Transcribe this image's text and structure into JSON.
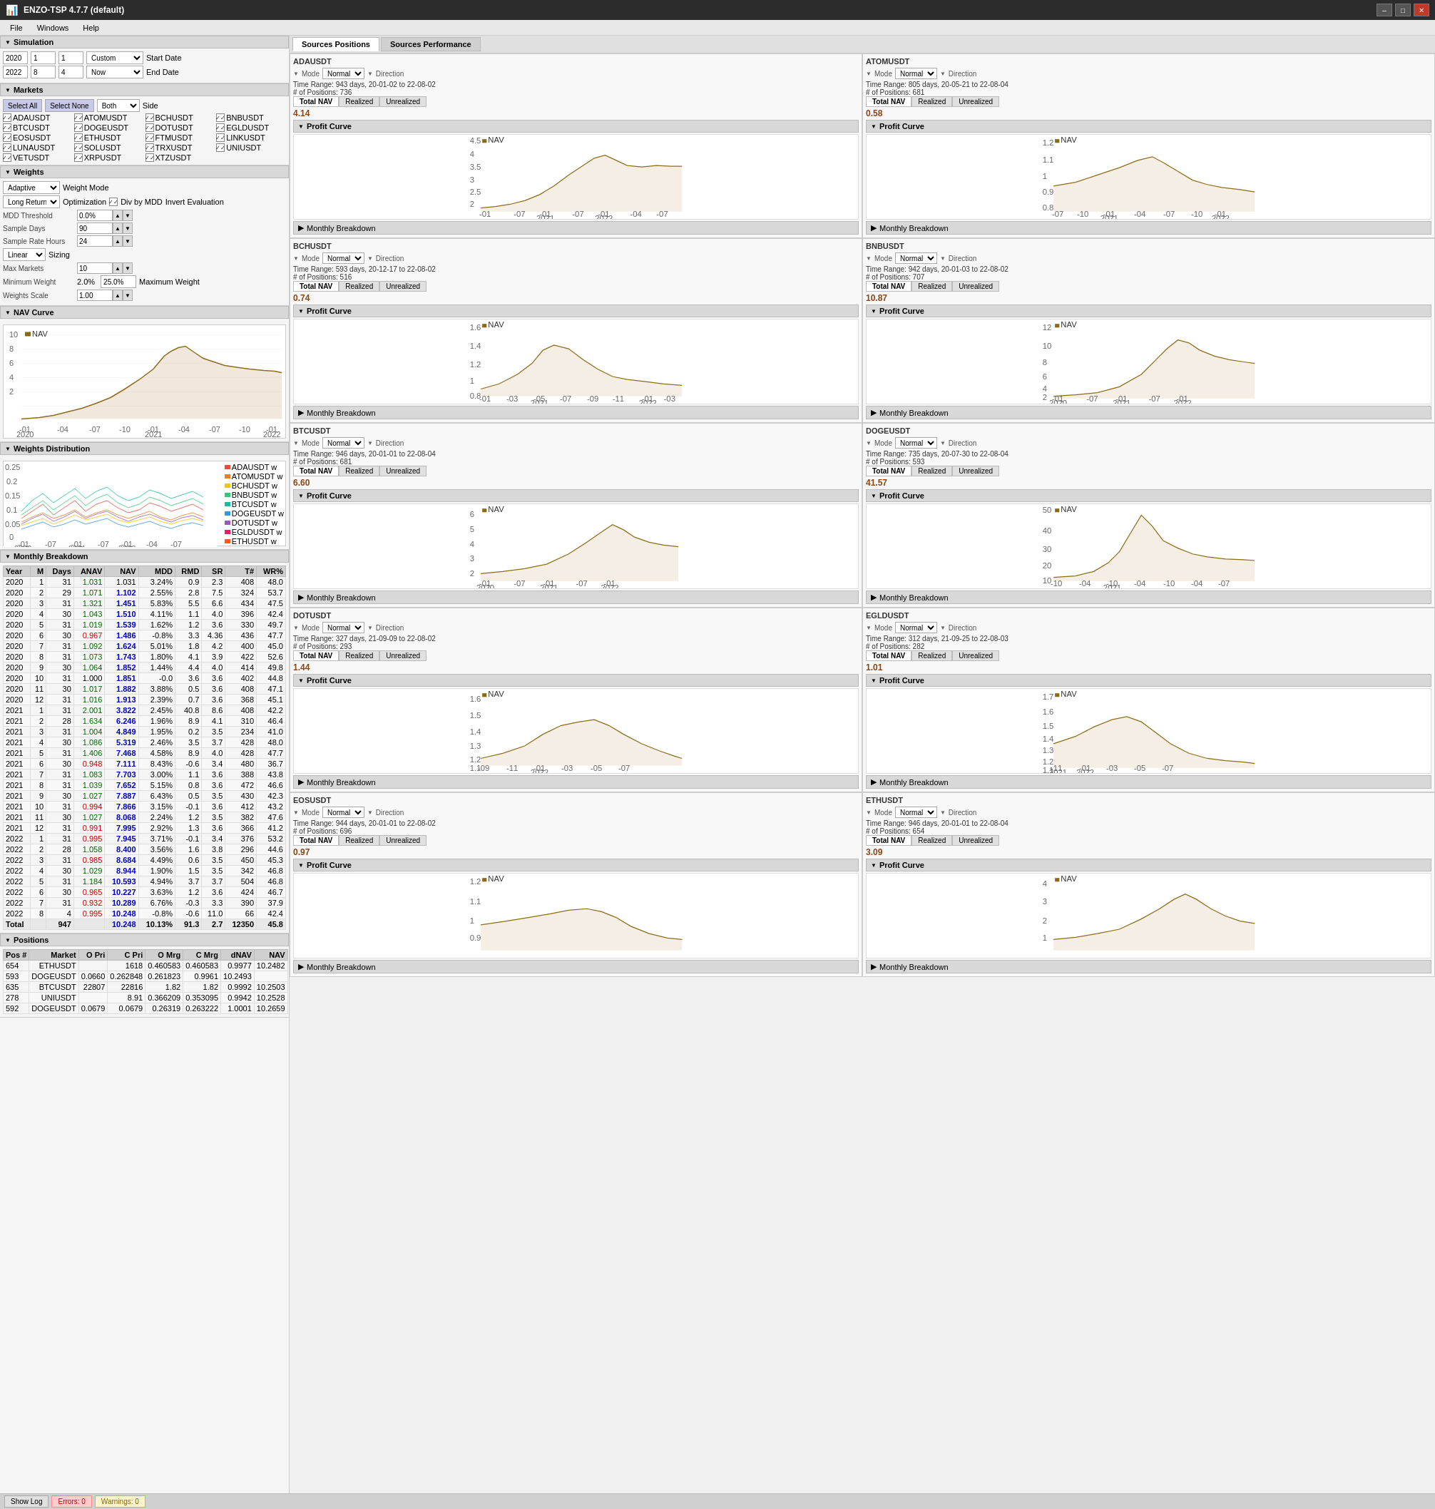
{
  "app": {
    "title": "ENZO-TSP 4.7.7 (default)",
    "menu": [
      "File",
      "Windows",
      "Help"
    ]
  },
  "simulation": {
    "label": "Simulation",
    "year": "2020",
    "m1": "1",
    "d1": "1",
    "year2": "2022",
    "m2": "8",
    "d2": "4",
    "preset": "Custom",
    "start_label": "Start Date",
    "end_label": "End Date",
    "now_label": "Now"
  },
  "markets": {
    "label": "Markets",
    "select_all": "Select All",
    "select_none": "Select None",
    "side": "Both",
    "side_label": "Side",
    "items": [
      "ADAUSDT",
      "ATOMUSDT",
      "BCHUSDT",
      "BNBUSDT",
      "BTCUSDT",
      "DOGEUSDT",
      "DOTUSDT",
      "EGLDUSDT",
      "EOSUSDT",
      "ETHUSDT",
      "FTMUSDT",
      "LINKUSDT",
      "LUNAUSDT",
      "SOLUSDT",
      "TRXUSDT",
      "UNIUSDT",
      "VETUSDT",
      "XRPUSDT",
      "XTZUSDT",
      ""
    ]
  },
  "weights": {
    "label": "Weights",
    "mode": "Adaptive",
    "weight_mode_label": "Weight Mode",
    "optimization": "Long Return",
    "opt_label": "Optimization",
    "div_mdd": "Div by MDD",
    "invert_eval": "Invert Evaluation",
    "mdd_threshold_label": "MDD Threshold",
    "mdd_threshold": "0.0%",
    "sample_days_label": "Sample Days",
    "sample_days": "90",
    "sample_rate_label": "Sample Rate Hours",
    "sample_rate": "24",
    "sizing": "Linear",
    "sizing_label": "Sizing",
    "max_markets_label": "Max Markets",
    "max_markets": "10",
    "min_weight_label": "Minimum Weight",
    "min_weight": "2.0%",
    "max_weight_label": "Maximum Weight",
    "max_weight": "25.0%",
    "weights_scale_label": "Weights Scale",
    "weights_scale": "1.00"
  },
  "sources_tabs": [
    "Sources Positions",
    "Sources Performance"
  ],
  "sources_active": 0,
  "sources": [
    {
      "id": "ADAUSDT",
      "mode": "Normal",
      "direction": "Direction",
      "time_range": "Time Range:   943 days, 20-01-02 to 22-08-02",
      "positions": "# of Positions:  736",
      "total_nav": "4.14",
      "chart_data": "up"
    },
    {
      "id": "ATOMUSDT",
      "mode": "Normal",
      "direction": "Direction",
      "time_range": "Time Range:   805 days, 20-05-21 to 22-08-04",
      "positions": "# of Positions:  681",
      "total_nav": "0.58",
      "chart_data": "flat"
    },
    {
      "id": "BCHUSDT",
      "mode": "Normal",
      "direction": "Direction",
      "time_range": "Time Range:   593 days, 20-12-17 to 22-08-02",
      "positions": "# of Positions:  516",
      "total_nav": "0.74",
      "chart_data": "peak"
    },
    {
      "id": "BNBUSDT",
      "mode": "Normal",
      "direction": "Direction",
      "time_range": "Time Range:   942 days, 20-01-03 to 22-08-02",
      "positions": "# of Positions:  707",
      "total_nav": "10.87",
      "chart_data": "up2"
    },
    {
      "id": "BTCUSDT",
      "mode": "Normal",
      "direction": "Direction",
      "time_range": "Time Range:   946 days, 20-01-01 to 22-08-04",
      "positions": "# of Positions:  681",
      "total_nav": "6.60",
      "chart_data": "btc"
    },
    {
      "id": "DOGEUSDT",
      "mode": "Normal",
      "direction": "Direction",
      "time_range": "Time Range:   735 days, 20-07-30 to 22-08-04",
      "positions": "# of Positions:  593",
      "total_nav": "41.57",
      "chart_data": "doge"
    },
    {
      "id": "DOTUSDT",
      "mode": "Normal",
      "direction": "Direction",
      "time_range": "Time Range:   327 days, 21-09-09 to 22-08-02",
      "positions": "# of Positions:  293",
      "total_nav": "1.44",
      "chart_data": "flat2"
    },
    {
      "id": "EGLDUSDT",
      "mode": "Normal",
      "direction": "Direction",
      "time_range": "Time Range:   312 days, 21-09-25 to 22-08-03",
      "positions": "# of Positions:  282",
      "total_nav": "1.01",
      "chart_data": "flat3"
    },
    {
      "id": "EOSUSDT",
      "mode": "Normal",
      "direction": "Direction",
      "time_range": "Time Range:   944 days, 20-01-01 to 22-08-02",
      "positions": "# of Positions:  696",
      "total_nav": "0.97",
      "chart_data": "flat4"
    },
    {
      "id": "ETHUSDT",
      "mode": "Normal",
      "direction": "Direction",
      "time_range": "Time Range:   946 days, 20-01-01 to 22-08-04",
      "positions": "# of Positions:  654",
      "total_nav": "3.09",
      "chart_data": "eth"
    }
  ],
  "monthly_table": {
    "headers": [
      "Year",
      "M",
      "Days",
      "ANAV",
      "NAV",
      "MDD",
      "RMD",
      "SR",
      "T#",
      "WR%"
    ],
    "rows": [
      [
        "2020",
        "1",
        "31",
        "1.031",
        "1.031",
        "3.24%",
        "0.9",
        "2.3",
        "408",
        "48.0"
      ],
      [
        "2020",
        "2",
        "29",
        "1.071",
        "1.102",
        "2.55%",
        "2.8",
        "7.5",
        "324",
        "53.7"
      ],
      [
        "2020",
        "3",
        "31",
        "1.321",
        "1.451",
        "5.83%",
        "5.5",
        "6.6",
        "434",
        "47.5"
      ],
      [
        "2020",
        "4",
        "30",
        "1.043",
        "1.510",
        "4.11%",
        "1.1",
        "4.0",
        "396",
        "42.4"
      ],
      [
        "2020",
        "5",
        "31",
        "1.019",
        "1.539",
        "1.62%",
        "1.2",
        "3.6",
        "330",
        "49.7"
      ],
      [
        "2020",
        "6",
        "30",
        "0.967",
        "1.486",
        "-0.8%",
        "3.3",
        "4.36",
        "436",
        "47.7"
      ],
      [
        "2020",
        "7",
        "31",
        "1.092",
        "1.624",
        "5.01%",
        "1.8",
        "4.2",
        "400",
        "45.0"
      ],
      [
        "2020",
        "8",
        "31",
        "1.073",
        "1.743",
        "1.80%",
        "4.1",
        "3.9",
        "422",
        "52.6"
      ],
      [
        "2020",
        "9",
        "30",
        "1.064",
        "1.852",
        "1.44%",
        "4.4",
        "4.0",
        "414",
        "49.8"
      ],
      [
        "2020",
        "10",
        "31",
        "1.000",
        "1.851",
        "-0.0",
        "3.6",
        "3.6",
        "402",
        "44.8"
      ],
      [
        "2020",
        "11",
        "30",
        "1.017",
        "1.882",
        "3.88%",
        "0.5",
        "3.6",
        "408",
        "47.1"
      ],
      [
        "2020",
        "12",
        "31",
        "1.016",
        "1.913",
        "2.39%",
        "0.7",
        "3.6",
        "368",
        "45.1"
      ],
      [
        "2021",
        "1",
        "31",
        "2.001",
        "3.822",
        "2.45%",
        "40.8",
        "8.6",
        "408",
        "42.2"
      ],
      [
        "2021",
        "2",
        "28",
        "1.634",
        "6.246",
        "1.96%",
        "8.9",
        "4.1",
        "310",
        "46.4"
      ],
      [
        "2021",
        "3",
        "31",
        "1.004",
        "4.849",
        "1.95%",
        "0.2",
        "3.5",
        "234",
        "41.0"
      ],
      [
        "2021",
        "4",
        "30",
        "1.086",
        "5.319",
        "2.46%",
        "3.5",
        "3.7",
        "428",
        "48.0"
      ],
      [
        "2021",
        "5",
        "31",
        "1.406",
        "7.468",
        "4.58%",
        "8.9",
        "4.0",
        "428",
        "47.7"
      ],
      [
        "2021",
        "6",
        "30",
        "0.948",
        "7.111",
        "8.43%",
        "-0.6",
        "3.4",
        "480",
        "36.7"
      ],
      [
        "2021",
        "7",
        "31",
        "1.083",
        "7.703",
        "3.00%",
        "1.1",
        "3.6",
        "388",
        "43.8"
      ],
      [
        "2021",
        "8",
        "31",
        "1.039",
        "7.652",
        "5.15%",
        "0.8",
        "3.6",
        "472",
        "46.6"
      ],
      [
        "2021",
        "9",
        "30",
        "1.027",
        "7.887",
        "6.43%",
        "0.5",
        "3.5",
        "430",
        "42.3"
      ],
      [
        "2021",
        "10",
        "31",
        "0.994",
        "7.866",
        "3.15%",
        "-0.1",
        "3.6",
        "412",
        "43.2"
      ],
      [
        "2021",
        "11",
        "30",
        "1.027",
        "8.068",
        "2.24%",
        "1.2",
        "3.5",
        "382",
        "47.6"
      ],
      [
        "2021",
        "12",
        "31",
        "0.991",
        "7.995",
        "2.92%",
        "1.3",
        "3.6",
        "366",
        "41.2"
      ],
      [
        "2022",
        "1",
        "31",
        "0.995",
        "7.945",
        "3.71%",
        "-0.1",
        "3.4",
        "376",
        "53.2"
      ],
      [
        "2022",
        "2",
        "28",
        "1.058",
        "8.400",
        "3.56%",
        "1.6",
        "3.8",
        "296",
        "44.6"
      ],
      [
        "2022",
        "3",
        "31",
        "0.985",
        "8.684",
        "4.49%",
        "0.6",
        "3.5",
        "450",
        "45.3"
      ],
      [
        "2022",
        "4",
        "30",
        "1.029",
        "8.944",
        "1.90%",
        "1.5",
        "3.5",
        "342",
        "46.8"
      ],
      [
        "2022",
        "5",
        "31",
        "1.184",
        "10.593",
        "4.94%",
        "3.7",
        "3.7",
        "504",
        "46.8"
      ],
      [
        "2022",
        "6",
        "30",
        "0.965",
        "10.227",
        "3.63%",
        "1.2",
        "3.6",
        "424",
        "46.7"
      ],
      [
        "2022",
        "7",
        "31",
        "0.932",
        "10.289",
        "6.76%",
        "-0.3",
        "3.3",
        "390",
        "37.9"
      ],
      [
        "2022",
        "8",
        "4",
        "0.995",
        "10.248",
        "-0.8%",
        "-0.6",
        "11.0",
        "66",
        "42.4"
      ],
      [
        "Total",
        "",
        "947",
        "",
        "10.248",
        "10.13%",
        "91.3",
        "2.7",
        "12350",
        "45.8"
      ]
    ]
  },
  "positions": {
    "label": "Positions",
    "headers": [
      "Pos#",
      "Market",
      "O Pri",
      "C Pri",
      "O Mrg",
      "C Mrg",
      "dNAV",
      "NAV"
    ],
    "rows": [
      [
        "654",
        "ETHUSDT",
        "",
        "1618",
        "0.460583",
        "0.460583",
        "0.9977",
        "10.2482"
      ],
      [
        "593",
        "DOGEUSDT",
        "0.0660",
        "0.262848",
        "0.261823",
        "0.9961",
        "10.2493",
        ""
      ],
      [
        "635",
        "BTCUSDT",
        "22807",
        "22816",
        "1.82",
        "1.82",
        "0.9992",
        "10.2503"
      ],
      [
        "278",
        "UNIUSDT",
        "",
        "8.91",
        "0.366209",
        "0.353095",
        "0.9942",
        "10.2528"
      ],
      [
        "592",
        "DOGEUSDT",
        "0.0679",
        "0.0679",
        "0.26319",
        "0.263222",
        "1.0001",
        "10.2659"
      ]
    ]
  },
  "bottom_bar": {
    "show_log": "Show Log",
    "errors": "Errors: 0",
    "warnings": "Warnings: 0"
  },
  "nav_curve": {
    "title": "NAV Curve",
    "nav_label": "NAV",
    "x_labels": [
      "-01\n2020",
      "-04",
      "-07",
      "-10",
      "-01\n2021",
      "-04",
      "-07",
      "-10",
      "-01\n2022",
      "-04",
      "-07"
    ]
  },
  "weights_dist": {
    "title": "Weights Distribution",
    "y_labels": [
      "0.25",
      "0.2",
      "0.15",
      "0.1",
      "0.05",
      "0"
    ],
    "legend": [
      {
        "name": "ADAUSDT w",
        "color": "#e74c3c"
      },
      {
        "name": "ATOMUSDT w",
        "color": "#e67e22"
      },
      {
        "name": "BCHUSDT w",
        "color": "#f1c40f"
      },
      {
        "name": "BNBUSDT w",
        "color": "#2ecc71"
      },
      {
        "name": "BTCUSDT w",
        "color": "#1abc9c"
      },
      {
        "name": "DOGEUSDT w",
        "color": "#3498db"
      },
      {
        "name": "DOTUSDT w",
        "color": "#9b59b6"
      },
      {
        "name": "EGLDUSDT w",
        "color": "#e91e63"
      },
      {
        "name": "ETHUSDT w",
        "color": "#ff5722"
      }
    ]
  }
}
